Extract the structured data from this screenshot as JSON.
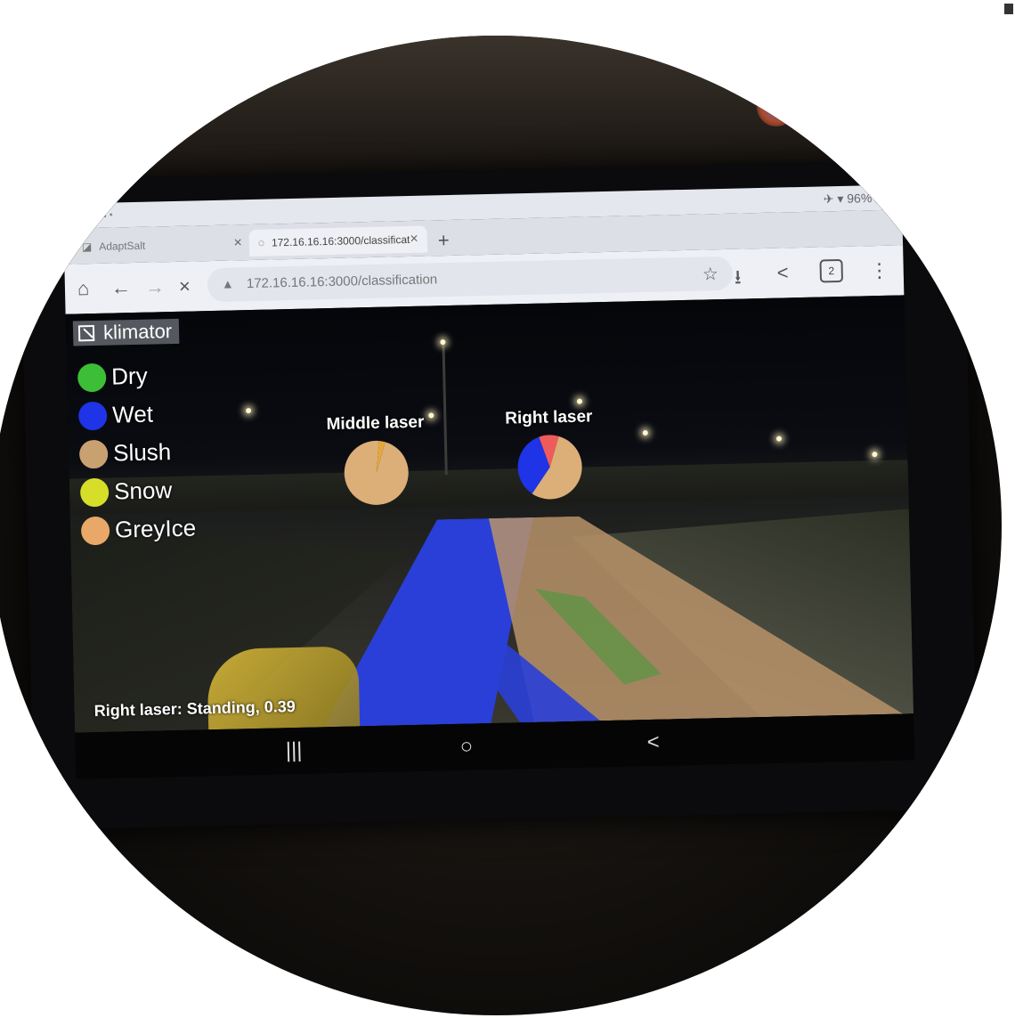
{
  "status_bar": {
    "left_icons": "⋯ ▲ ■ •",
    "right": "96%"
  },
  "tabs": [
    {
      "title": "AdaptSalt",
      "close": "×"
    },
    {
      "title": "172.16.16.16:3000/classificat",
      "close": "×"
    }
  ],
  "new_tab": "+",
  "toolbar": {
    "home": "⌂",
    "back": "←",
    "forward": "→",
    "stop": "×",
    "url": "172.16.16.16:3000/classification",
    "warning": "▲",
    "bookmark": "☆",
    "download": "⭳",
    "share": "<",
    "tab_count": "2",
    "menu": "⋮"
  },
  "app": {
    "brand": "klimator",
    "legend": [
      {
        "label": "Dry",
        "color": "#3cbf36"
      },
      {
        "label": "Wet",
        "color": "#1e34e6"
      },
      {
        "label": "Slush",
        "color": "#c9a070"
      },
      {
        "label": "Snow",
        "color": "#d6de2a"
      },
      {
        "label": "GreyIce",
        "color": "#e9a868"
      }
    ],
    "caption": "Right laser: Standing, 0.39"
  },
  "chart_data": [
    {
      "type": "pie",
      "title": "Middle laser",
      "categories": [
        "Slush",
        "GreyIce"
      ],
      "values": [
        0.97,
        0.03
      ],
      "colors": [
        "#dcae78",
        "#e5a83a"
      ]
    },
    {
      "type": "pie",
      "title": "Right laser",
      "categories": [
        "Slush",
        "Wet",
        "Red"
      ],
      "values": [
        0.55,
        0.35,
        0.1
      ],
      "colors": [
        "#dcae78",
        "#1e34e6",
        "#ef5b5b"
      ]
    }
  ],
  "nav_bar": {
    "recents": "|||",
    "home": "○",
    "back": "<"
  }
}
